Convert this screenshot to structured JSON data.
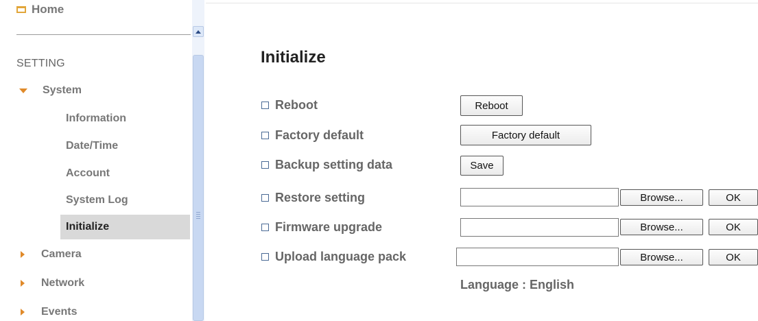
{
  "sidebar": {
    "home_label": "Home",
    "section_heading": "SETTING",
    "system": {
      "label": "System",
      "items": [
        "Information",
        "Date/Time",
        "Account",
        "System Log",
        "Initialize"
      ],
      "active": "Initialize"
    },
    "groups": [
      "Camera",
      "Network",
      "Events"
    ]
  },
  "main": {
    "title": "Initialize",
    "rows": {
      "reboot": {
        "label": "Reboot",
        "button": "Reboot"
      },
      "factory": {
        "label": "Factory default",
        "button": "Factory default"
      },
      "backup": {
        "label": "Backup setting data",
        "button": "Save"
      },
      "restore": {
        "label": "Restore setting",
        "browse": "Browse...",
        "ok": "OK",
        "value": ""
      },
      "firmware": {
        "label": "Firmware upgrade",
        "browse": "Browse...",
        "ok": "OK",
        "value": ""
      },
      "language_pack": {
        "label": "Upload language pack",
        "browse": "Browse...",
        "ok": "OK",
        "value": ""
      }
    },
    "language_status": "Language : English"
  },
  "colors": {
    "accent_triangle": "#e08a2a",
    "active_item_bg": "#d9d9d9",
    "scrollbar": "#c8d8f2"
  }
}
